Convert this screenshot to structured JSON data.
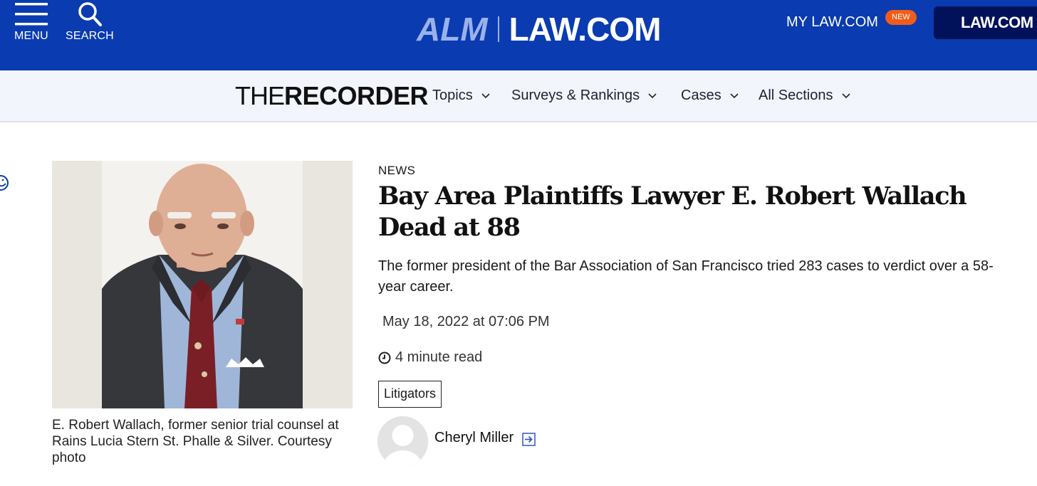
{
  "topbar": {
    "menu_label": "MENU",
    "search_label": "SEARCH",
    "logo_alm": "ALM",
    "logo_law": "LAW.COM",
    "mylaw_label": "MY LAW.COM",
    "new_badge": "NEW",
    "lawcom_button": "LAW.COM",
    "colors": {
      "bar": "#0a3bb0",
      "badge": "#f25c19",
      "button": "#02125a"
    }
  },
  "subnav": {
    "brand_the": "THE",
    "brand_recorder": "RECORDER",
    "items": [
      {
        "label": "Topics"
      },
      {
        "label": "Surveys & Rankings"
      },
      {
        "label": "Cases"
      },
      {
        "label": "All Sections"
      }
    ]
  },
  "photo": {
    "caption": "E. Robert Wallach, former senior trial counsel at Rains Lucia Stern St. Phalle & Silver. Courtesy photo"
  },
  "article": {
    "kicker": "NEWS",
    "headline": "Bay Area Plaintiffs Lawyer E. Robert Wallach Dead at 88",
    "dek": "The former president of the Bar Association of San Francisco tried 283 cases to verdict over a 58-year career.",
    "date": "May 18, 2022 at 07:06 PM",
    "read_time": "4 minute read",
    "tag": "Litigators",
    "author": "Cheryl Miller"
  },
  "icons": {
    "menu": "hamburger-icon",
    "search": "search-icon",
    "chevron": "chevron-down-icon",
    "clock": "clock-icon",
    "author_link": "arrow-link-icon",
    "avatar": "avatar-placeholder-icon"
  }
}
